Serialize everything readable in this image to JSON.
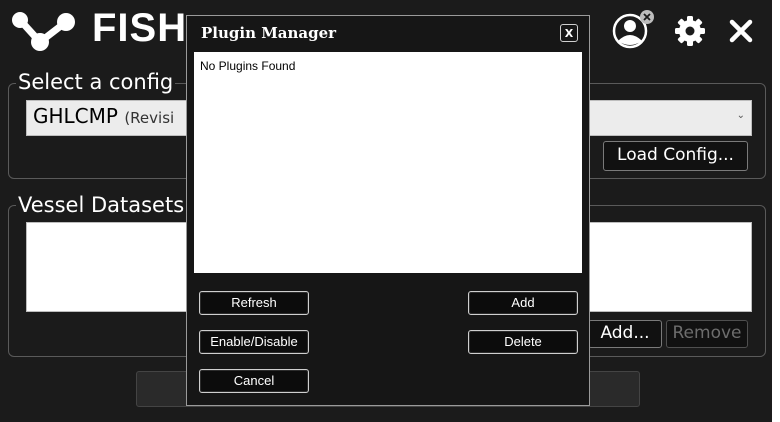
{
  "header": {
    "app_name": "FISH",
    "icons": [
      "logo-icon",
      "user-icon",
      "gear-icon",
      "close-icon"
    ]
  },
  "config_panel": {
    "title": "Select a config",
    "selected_config": "GHLCMP",
    "selected_config_sub": "(Revisi",
    "load_button": "Load Config..."
  },
  "vessel_panel": {
    "title": "Vessel Datasets",
    "add_button": "Add...",
    "remove_button": "Remove"
  },
  "dialog": {
    "title": "Plugin Manager",
    "close_label": "X",
    "empty_message": "No Plugins Found",
    "buttons": {
      "refresh": "Refresh",
      "add": "Add",
      "enable_disable": "Enable/Disable",
      "delete": "Delete",
      "cancel": "Cancel"
    }
  },
  "colors": {
    "background": "#1b1b1b",
    "dialog_background": "#161616",
    "text": "#ffffff"
  }
}
